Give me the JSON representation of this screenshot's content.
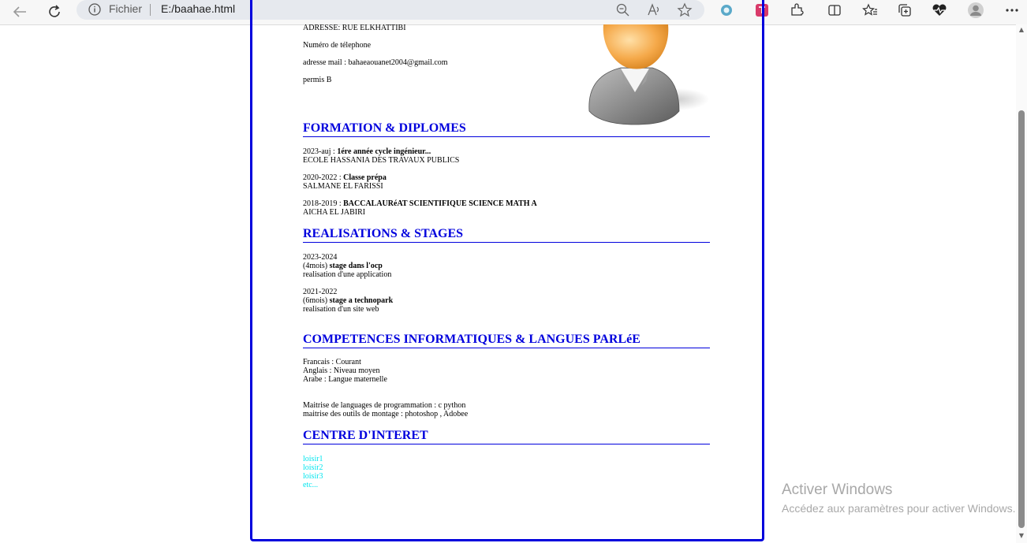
{
  "browser": {
    "address_scheme_label": "Fichier",
    "url": "E:/baahae.html",
    "icons": [
      "back-icon",
      "refresh-icon",
      "info-icon",
      "zoom-icon",
      "read-aloud-icon",
      "favorite-icon",
      "extension-1-icon",
      "extension-2-icon",
      "extensions-icon",
      "split-screen-icon",
      "favorites-icon",
      "collections-icon",
      "performance-icon",
      "profile-icon",
      "more-icon"
    ]
  },
  "cv": {
    "contact": {
      "address": "ADRESSE: RUE ELKHATTIBI",
      "phone": "Numéro de télephone",
      "email": "adresse mail : bahaeaouanet2004@gmail.com",
      "license": "permis B"
    },
    "formation": {
      "title": "FORMATION & DIPLOMES",
      "items": [
        {
          "years": "2023-auj : ",
          "degree": "1ére année cycle ingénieur...",
          "school": "ECOLE HASSANIA DES TRAVAUX PUBLICS"
        },
        {
          "years": "2020-2022 : ",
          "degree": "Classe prépa",
          "school": "SALMANE EL FARISSI"
        },
        {
          "years": "2018-2019 : ",
          "degree": "BACCALAURéAT SCIENTIFIQUE SCIENCE MATH A",
          "school": "AICHA EL JABIRI"
        }
      ]
    },
    "stages": {
      "title": "REALISATIONS & STAGES",
      "items": [
        {
          "years": "2023-2024",
          "duration": "(4mois) ",
          "name": "stage dans l'ocp",
          "desc": "realisation d'une application"
        },
        {
          "years": "2021-2022",
          "duration": "(6mois) ",
          "name": "stage a technopark",
          "desc": "realisation d'un site web"
        }
      ]
    },
    "skills": {
      "title": "COMPETENCES INFORMATIQUES & LANGUES PARLéE",
      "languages": [
        "Francais : Courant",
        "Anglais : Niveau moyen",
        "Arabe : Langue maternelle"
      ],
      "tech": [
        "Maitrise de languages de programmation : c python",
        "maitrise des outils de montage : photoshop , Adobee"
      ]
    },
    "interests": {
      "title": "CENTRE D'INTERET",
      "items": [
        "loisir1",
        "loisir2",
        "loisir3",
        "etc..."
      ]
    }
  },
  "watermark": {
    "title": "Activer Windows",
    "subtitle": "Accédez aux paramètres pour activer Windows."
  },
  "colors": {
    "accent": "#0000dd",
    "leisure": "#00e5ee"
  }
}
